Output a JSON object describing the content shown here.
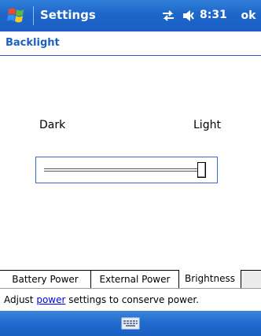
{
  "titlebar": {
    "app_title": "Settings",
    "clock": "8:31",
    "ok_label": "ok",
    "icons": [
      "windows-start-icon",
      "connectivity-icon",
      "speaker-volume-icon"
    ]
  },
  "page": {
    "heading": "Backlight"
  },
  "slider": {
    "min_label": "Dark",
    "max_label": "Light",
    "value_fraction": 1.0
  },
  "tabs": [
    {
      "label": "Battery Power",
      "active": false
    },
    {
      "label": "External Power",
      "active": false
    },
    {
      "label": "Brightness",
      "active": true
    }
  ],
  "status": {
    "prefix": "Adjust ",
    "link": "power",
    "suffix": " settings to conserve power."
  },
  "bottombar": {
    "icons": [
      "keyboard-icon"
    ]
  },
  "colors": {
    "titlebar_blue": "#1e66c9",
    "heading_blue": "#1d5fbf",
    "link_blue": "#0000ee"
  }
}
